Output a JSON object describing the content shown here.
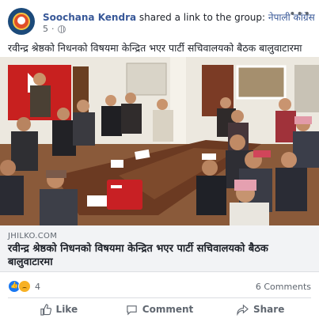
{
  "post": {
    "author": "Soochana Kendra",
    "action": "shared a link to the group:",
    "group": "नेपाली कांग्रेस",
    "time": "5",
    "message": "रवीन्द्र श्रेष्ठको निधनको विषयमा केन्द्रित भएर पार्टी सचिवालयको बैठक बालुवाटारमा",
    "more_icon": "more-options-icon",
    "privacy_icon": "globe-icon"
  },
  "link": {
    "domain": "JHILKO.COM",
    "title": "रवीन्द्र श्रेष्ठको निधनको विषयमा केन्द्रित भएर पार्टी सचिवालयको बैठक बालुवाटारमा"
  },
  "stats": {
    "reaction_count": "4",
    "comments": "6 Comments",
    "reactions": [
      "like",
      "sad"
    ]
  },
  "actions": {
    "like": "Like",
    "comment": "Comment",
    "share": "Share"
  },
  "colors": {
    "link_blue": "#385898",
    "muted": "#606770",
    "link_bg": "#f2f3f5"
  }
}
